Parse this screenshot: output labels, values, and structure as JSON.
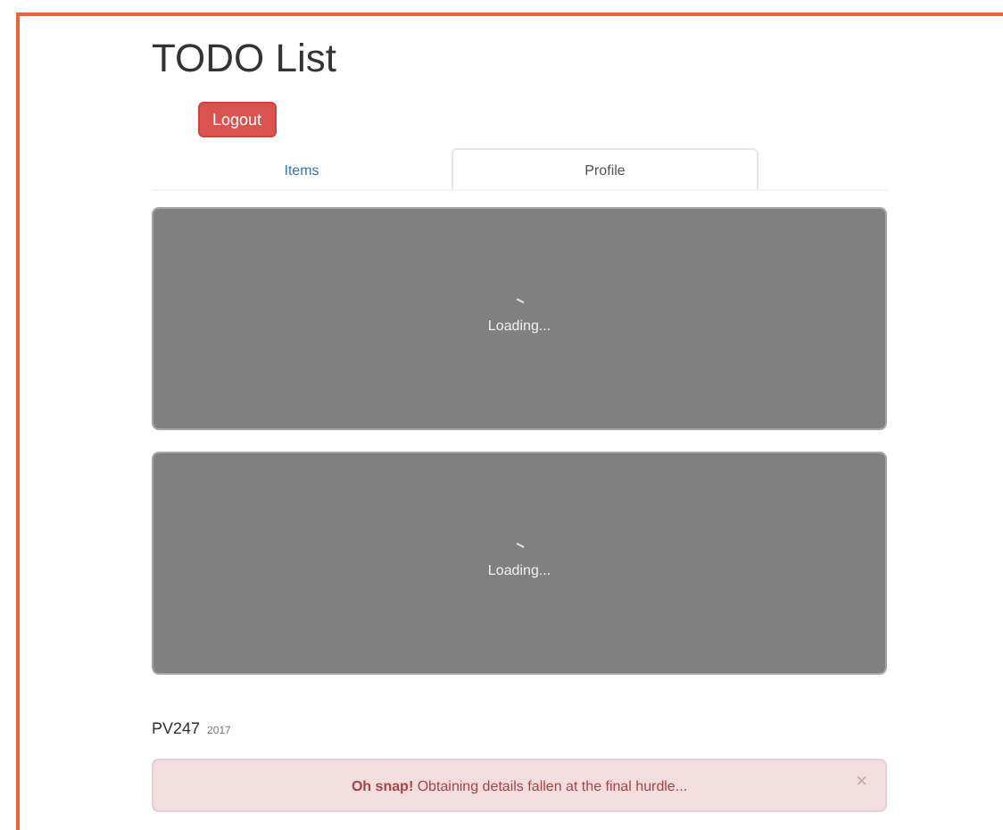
{
  "title": "TODO List",
  "logout_button": "Logout",
  "tabs": [
    {
      "label": "Items",
      "selected": false
    },
    {
      "label": "Profile",
      "selected": true
    }
  ],
  "panels": [
    {
      "loading_text": "Loading..."
    },
    {
      "loading_text": "Loading..."
    }
  ],
  "footer": {
    "name": "PV247",
    "year": "2017"
  },
  "alert": {
    "message": "**Oh snap!** Obtaining details fallen at the final hurdle...",
    "close": "×"
  }
}
